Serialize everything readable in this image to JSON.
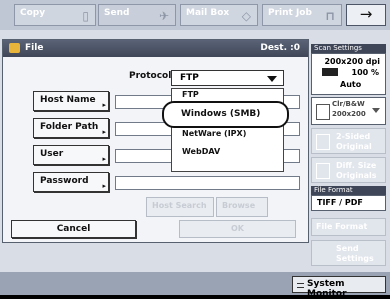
{
  "top_tabs": [
    {
      "label": "Copy",
      "icon": "copy-icon"
    },
    {
      "label": "Send",
      "icon": "send-icon"
    },
    {
      "label": "Mail Box",
      "icon": "mailbox-icon"
    },
    {
      "label": "Print Job",
      "icon": "printer-icon"
    }
  ],
  "arrow_icon": "→",
  "window": {
    "title": "File",
    "dest": "Dest. :0",
    "protocol_label": "Protocol:",
    "protocol_value": "FTP",
    "host_name": "Host Name",
    "folder_path": "Folder Path",
    "user": "User",
    "password": "Password",
    "host_search": "Host Search",
    "browse": "Browse",
    "cancel": "Cancel",
    "ok": "OK"
  },
  "dropdown_options": [
    "FTP",
    "Windows (SMB)",
    "NetWare (IPX)",
    "WebDAV"
  ],
  "selected_option": "Windows (SMB)",
  "right_panel": {
    "scan_settings_label": "Scan Settings",
    "resolution": "200x200 dpi",
    "zoom": "100 %",
    "auto": "Auto",
    "color_mode": [
      "Clr/B&W",
      "200x200"
    ],
    "two_sided": [
      "2-Sided",
      "Original"
    ],
    "diff_size": [
      "Diff. Size",
      "Originals"
    ],
    "file_format_label": "File Format",
    "file_format_value": "TIFF / PDF",
    "file_format_btn": "File Format",
    "send_settings": [
      "Send",
      "Settings"
    ]
  },
  "system_monitor": "System Monitor"
}
